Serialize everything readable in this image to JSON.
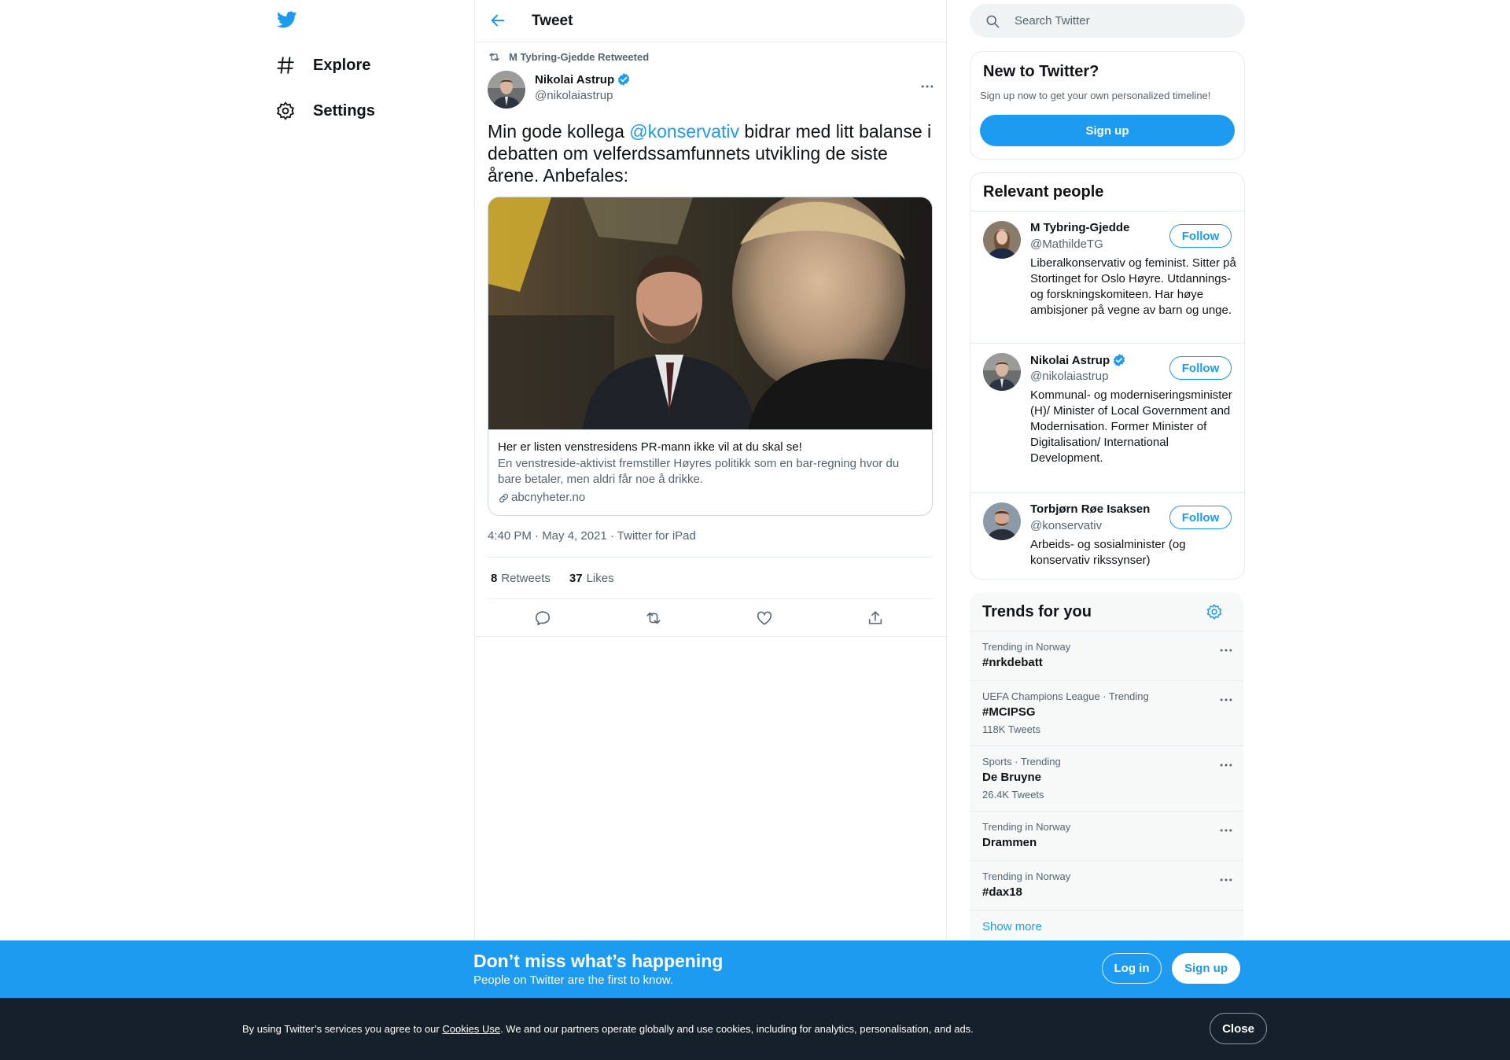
{
  "nav": {
    "explore": "Explore",
    "settings": "Settings"
  },
  "header": {
    "title": "Tweet"
  },
  "tweet": {
    "retweeted_by": "M Tybring-Gjedde Retweeted",
    "author_name": "Nikolai Astrup",
    "author_handle": "@nikolaiastrup",
    "text_before": "Min gode kollega ",
    "mention": "@konservativ",
    "text_after": " bidrar med litt balanse i debatten om velferdssamfunnets utvikling de siste årene. Anbefales:",
    "card": {
      "title": "Her er listen venstresidens PR-mann ikke vil at du skal se!",
      "description": "En venstreside-aktivist fremstiller Høyres politikk som en bar-regning hvor du bare betaler, men aldri får noe å drikke.",
      "domain": "abcnyheter.no"
    },
    "meta": "4:40 PM · May 4, 2021 · Twitter for iPad",
    "retweets_count": "8",
    "retweets_label": "Retweets",
    "likes_count": "37",
    "likes_label": "Likes"
  },
  "search": {
    "placeholder": "Search Twitter"
  },
  "new_to_twitter": {
    "title": "New to Twitter?",
    "subtitle": "Sign up now to get your own personalized timeline!",
    "button": "Sign up"
  },
  "relevant": {
    "title": "Relevant people",
    "follow_label": "Follow",
    "people": [
      {
        "name": "M Tybring-Gjedde",
        "handle": "@MathildeTG",
        "bio": "Liberalkonservativ og feminist. Sitter på Stortinget for Oslo Høyre. Utdannings- og forskningskomiteen. Har høye ambisjoner på vegne av barn og unge."
      },
      {
        "name": "Nikolai Astrup",
        "handle": "@nikolaiastrup",
        "bio": "Kommunal- og moderniseringsminister (H)/ Minister of Local Government and Modernisation. Former Minister of Digitalisation/ International Development."
      },
      {
        "name": "Torbjørn Røe Isaksen",
        "handle": "@konservativ",
        "bio": "Arbeids- og sosialminister (og konservativ rikssynser)"
      }
    ]
  },
  "trends": {
    "title": "Trends for you",
    "items": [
      {
        "context": "Trending in Norway",
        "name": "#nrkdebatt",
        "count": ""
      },
      {
        "context": "UEFA Champions League · Trending",
        "name": "#MCIPSG",
        "count": "118K Tweets"
      },
      {
        "context": "Sports · Trending",
        "name": "De Bruyne",
        "count": "26.4K Tweets"
      },
      {
        "context": "Trending in Norway",
        "name": "Drammen",
        "count": ""
      },
      {
        "context": "Trending in Norway",
        "name": "#dax18",
        "count": ""
      }
    ],
    "show_more": "Show more"
  },
  "banner": {
    "title": "Don’t miss what’s happening",
    "subtitle": "People on Twitter are the first to know.",
    "login": "Log in",
    "signup": "Sign up"
  },
  "cookie": {
    "text_before": "By using Twitter’s services you agree to our ",
    "link": "Cookies Use",
    "text_after": ". We and our partners operate globally and use cookies, including for analytics, personalisation, and ads.",
    "close": "Close"
  },
  "colors": {
    "accent": "#1d9bf0",
    "text": "#0f1419",
    "secondary": "#536471",
    "cookie_bg": "#15202b"
  }
}
